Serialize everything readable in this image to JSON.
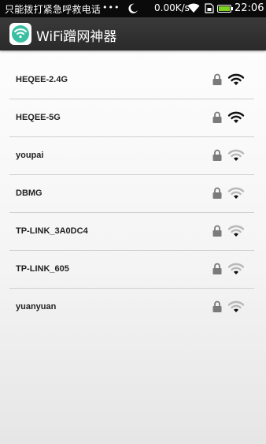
{
  "status_bar": {
    "carrier_text": "只能拨打紧急呼救电话",
    "dots": "•••",
    "speed": "0.00K/s",
    "time": "22:06"
  },
  "app": {
    "title": "WiFi蹭网神器"
  },
  "networks": [
    {
      "ssid": "HEQEE-2.4G",
      "locked": true,
      "signal": "strong"
    },
    {
      "ssid": "HEQEE-5G",
      "locked": true,
      "signal": "strong"
    },
    {
      "ssid": "youpai",
      "locked": true,
      "signal": "weak"
    },
    {
      "ssid": "DBMG",
      "locked": true,
      "signal": "weak"
    },
    {
      "ssid": "TP-LINK_3A0DC4",
      "locked": true,
      "signal": "weak"
    },
    {
      "ssid": "TP-LINK_605",
      "locked": true,
      "signal": "weak"
    },
    {
      "ssid": "yuanyuan",
      "locked": true,
      "signal": "weak"
    }
  ],
  "colors": {
    "app_bar": "#2e2e2e",
    "logo_accent": "#3bbfa3",
    "battery": "#7ed321",
    "signal_strong": "#111111",
    "signal_weak": "#b8b8b8"
  }
}
